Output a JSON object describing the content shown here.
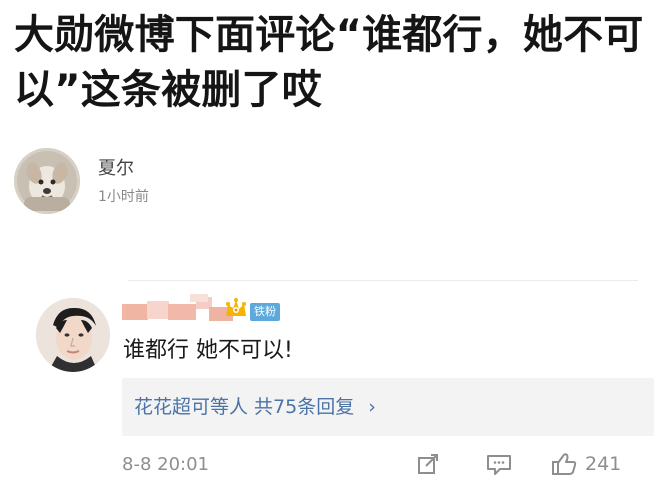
{
  "headline": "大勋微博下面评论“谁都行，她不可以”这条被删了哎",
  "post_author": {
    "name": "夏尔",
    "time": "1小时前",
    "avatar_icon": "dog-avatar-icon"
  },
  "comment": {
    "commenter_icon": "person-avatar-icon",
    "crown_icon": "crown-icon",
    "badge": "铁粉",
    "text": "谁都行 她不可以!",
    "reply_link": "花花超可等人 共75条回复",
    "reply_chevron": "›",
    "date": "8-8 20:01",
    "actions": {
      "share_icon": "share-icon",
      "comment_icon": "comment-icon",
      "like_icon": "like-icon",
      "like_count": "241"
    }
  },
  "colors": {
    "text": "#151515",
    "muted": "#8a8a8a",
    "link": "#4b73a6",
    "badge": "#5da9dc",
    "reply_bg": "#f3f3f3"
  }
}
